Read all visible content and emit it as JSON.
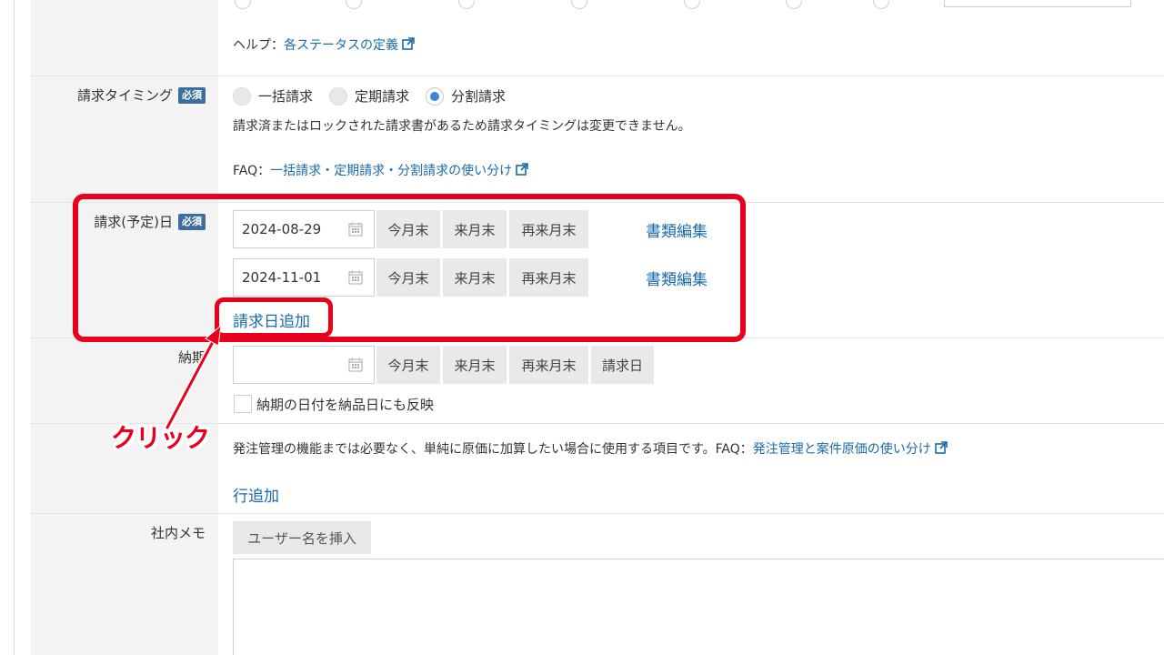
{
  "status_row": {
    "help_prefix": "ヘルプ：",
    "help_link": "各ステータスの定義"
  },
  "billing_timing": {
    "label": "請求タイミング",
    "required": "必須",
    "options": [
      "一括請求",
      "定期請求",
      "分割請求"
    ],
    "selected": "分割請求",
    "notice": "請求済またはロックされた請求書があるため請求タイミングは変更できません。",
    "faq_prefix": "FAQ：",
    "faq_link": "一括請求・定期請求・分割請求の使い分け"
  },
  "billing_date": {
    "label": "請求(予定)日",
    "required": "必須",
    "rows": [
      {
        "date": "2024-08-29",
        "btn1": "今月末",
        "btn2": "来月末",
        "btn3": "再来月末",
        "edit": "書類編集"
      },
      {
        "date": "2024-11-01",
        "btn1": "今月末",
        "btn2": "来月末",
        "btn3": "再来月末",
        "edit": "書類編集"
      }
    ],
    "add_link": "請求日追加"
  },
  "delivery": {
    "label": "納期",
    "date": "",
    "btn1": "今月末",
    "btn2": "来月末",
    "btn3": "再来月末",
    "btn4": "請求日",
    "checkbox_label": "納期の日付を納品日にも反映"
  },
  "cost": {
    "desc": "発注管理の機能までは必要なく、単純に原価に加算したい場合に使用する項目です。FAQ：",
    "faq_link": "発注管理と案件原価の使い分け",
    "add_row": "行追加"
  },
  "memo": {
    "label": "社内メモ",
    "insert_button": "ユーザー名を挿入",
    "value": ""
  },
  "annotation": {
    "click_text": "クリック",
    "color": "#e8001c"
  },
  "colors": {
    "link": "#1a6bab",
    "badge": "#3d6e9e",
    "radio_selected": "#3a86d6",
    "label_bg": "#f3f3f3"
  }
}
